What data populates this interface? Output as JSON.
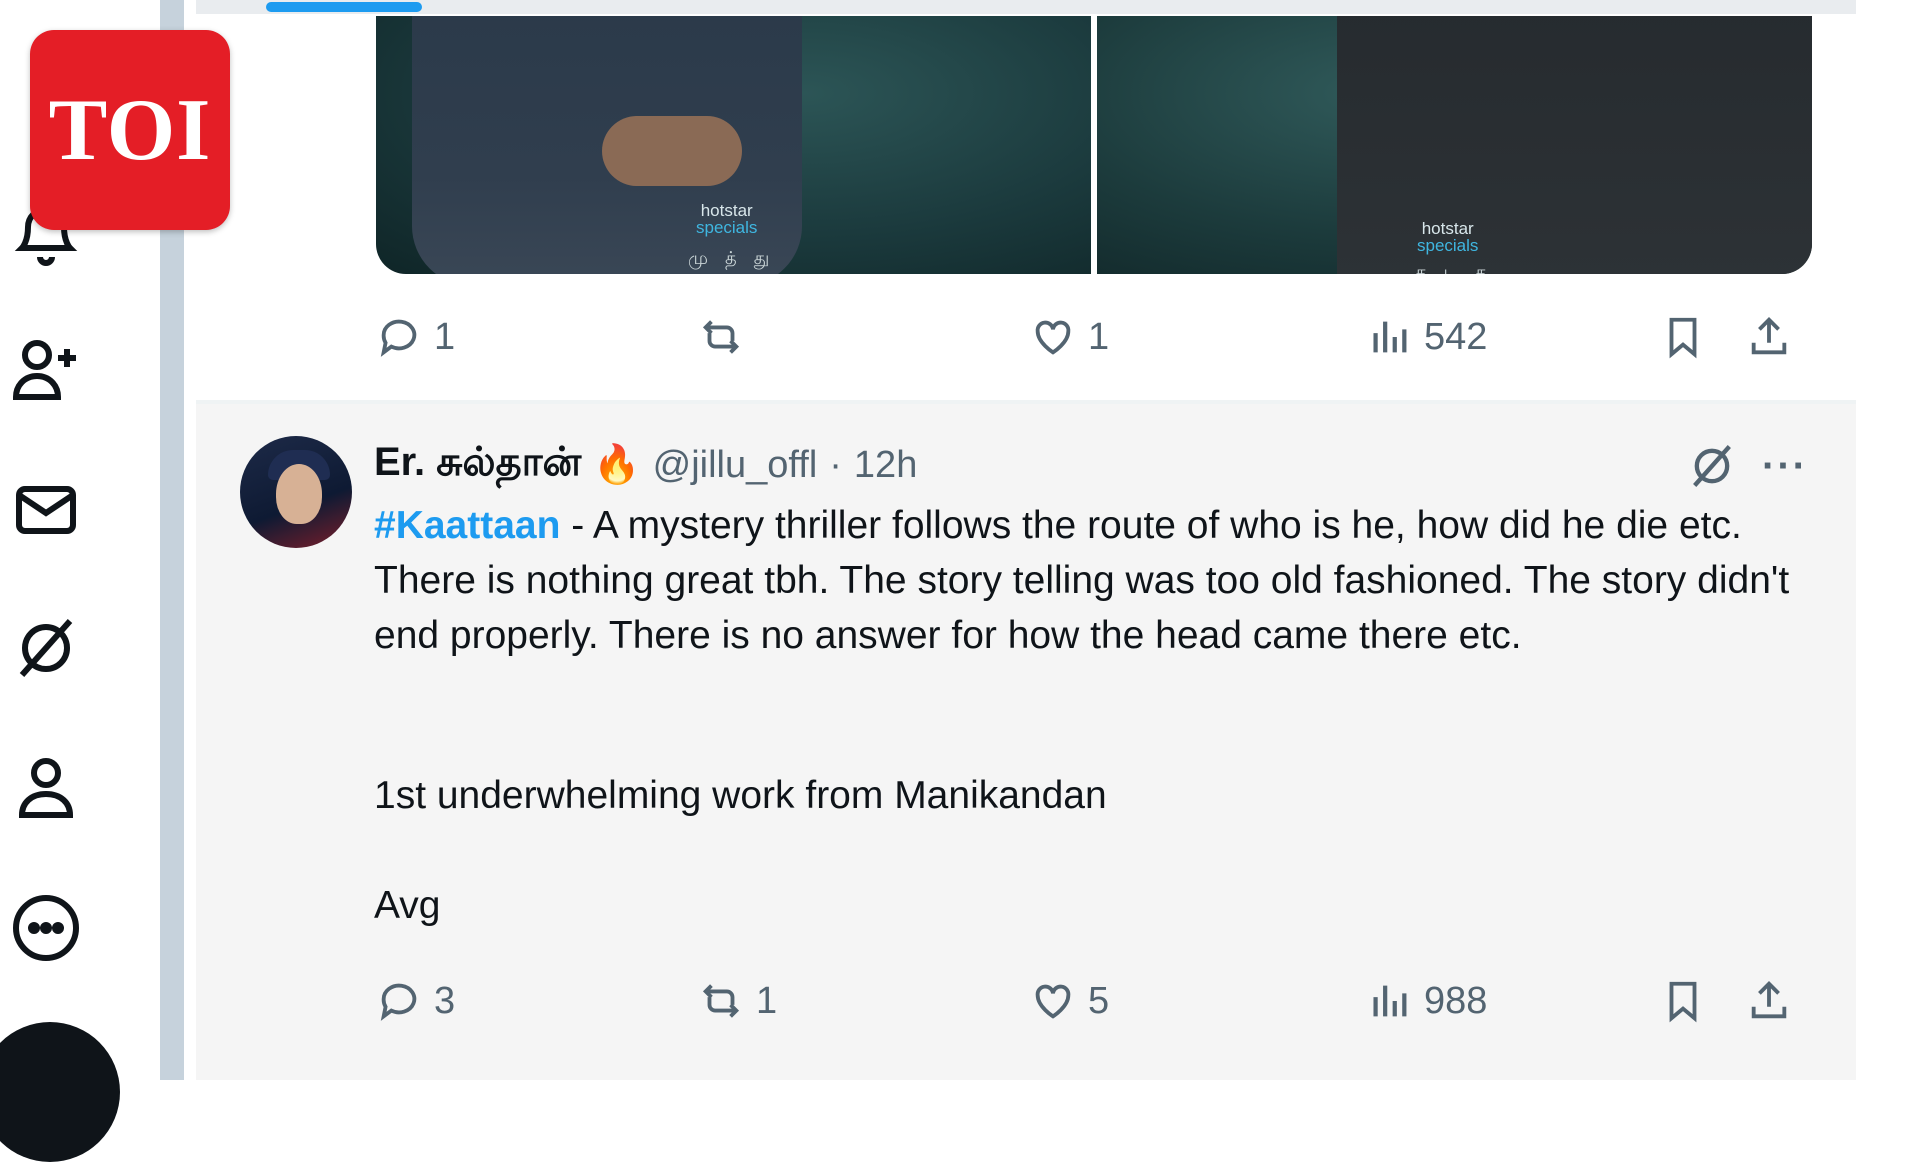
{
  "logo": {
    "text": "TOI"
  },
  "tweet1": {
    "media": {
      "brand_top": "hotstar",
      "brand_bottom": "specials",
      "credit_left": "மு த் து",
      "credit_right": "க ட க"
    },
    "replies": "1",
    "retweets": "",
    "likes": "1",
    "views": "542"
  },
  "tweet2": {
    "name": "Er. சுல்தான்",
    "emoji": "🔥",
    "handle": "@jillu_offl",
    "separator": "·",
    "time": "12h",
    "hashtag": "#Kaattaan",
    "body": " - A mystery thriller follows the route of who is he, how did he die etc. There is nothing great tbh. The story telling was too old fashioned. The story didn't end properly. There is no answer for how the head came there etc.",
    "para2": "1st underwhelming work from Manikandan",
    "para3": "Avg",
    "more": "···",
    "replies": "3",
    "retweets": "1",
    "likes": "5",
    "views": "988"
  },
  "icons": {
    "nav": [
      "notifications-icon",
      "follow-icon",
      "messages-icon",
      "grok-icon",
      "profile-icon",
      "more-icon"
    ],
    "actions": [
      "reply-icon",
      "retweet-icon",
      "like-icon",
      "views-icon",
      "bookmark-icon",
      "share-icon"
    ]
  },
  "colors": {
    "accent": "#1d9bf0",
    "logo_red": "#e41e26",
    "muted": "#536471"
  }
}
